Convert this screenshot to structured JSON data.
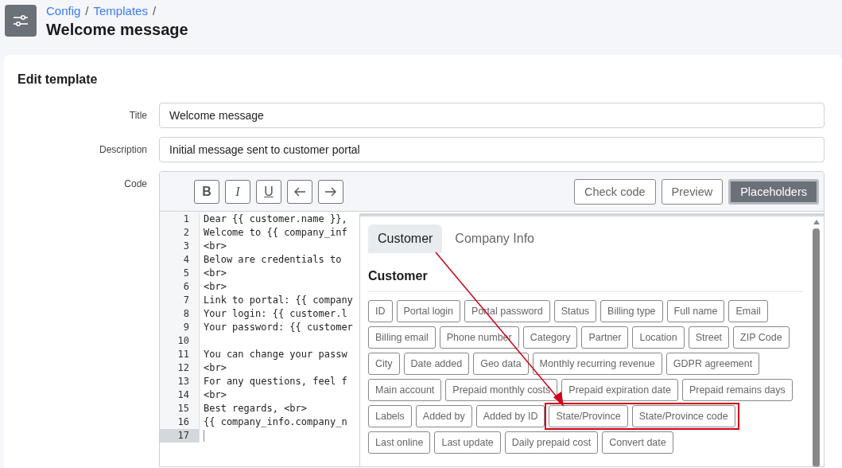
{
  "header": {
    "breadcrumb": [
      "Config",
      "Templates"
    ],
    "separator": "/",
    "title": "Welcome message"
  },
  "form": {
    "heading": "Edit template",
    "fields": [
      {
        "label": "Title",
        "value": "Welcome message"
      },
      {
        "label": "Description",
        "value": "Initial message sent to customer portal"
      }
    ],
    "code_label": "Code"
  },
  "toolbar": {
    "format_buttons": [
      {
        "kind": "bold",
        "label": "B"
      },
      {
        "kind": "italic",
        "label": "I"
      },
      {
        "kind": "underline",
        "label": "U"
      },
      {
        "kind": "undo"
      },
      {
        "kind": "redo"
      }
    ],
    "actions": [
      {
        "label": "Check code",
        "selected": false
      },
      {
        "label": "Preview",
        "selected": false
      },
      {
        "label": "Placeholders",
        "selected": true
      }
    ]
  },
  "code_lines": [
    {
      "number": "1",
      "text": "Dear {{ customer.name }},",
      "current": false
    },
    {
      "number": "2",
      "text": "Welcome to {{ company_inf",
      "current": false
    },
    {
      "number": "3",
      "text": "<br>",
      "current": false
    },
    {
      "number": "4",
      "text": "Below are credentials to",
      "current": false
    },
    {
      "number": "5",
      "text": "<br>",
      "current": false
    },
    {
      "number": "6",
      "text": "<br>",
      "current": false
    },
    {
      "number": "7",
      "text": "Link to portal: {{ company",
      "current": false
    },
    {
      "number": "8",
      "text": "Your login: {{ customer.l",
      "current": false
    },
    {
      "number": "9",
      "text": "Your password: {{ customer",
      "current": false
    },
    {
      "number": "10",
      "current": false
    },
    {
      "number": "11",
      "text": "You can change your passw",
      "current": false
    },
    {
      "number": "12",
      "text": "<br>",
      "current": false
    },
    {
      "number": "13",
      "text": "For any questions, feel f",
      "current": false
    },
    {
      "number": "14",
      "text": "<br>",
      "current": false
    },
    {
      "number": "15",
      "text": "Best regards, <br>",
      "current": false
    },
    {
      "number": "16",
      "text": "{{ company_info.company_n",
      "current": false
    },
    {
      "number": "17",
      "current": true
    }
  ],
  "placeholders": {
    "tabs": [
      {
        "label": "Customer",
        "selected": true
      },
      {
        "label": "Company Info",
        "selected": false
      }
    ],
    "section_title": "Customer",
    "chips": [
      {
        "label": "ID",
        "highlighted": false
      },
      {
        "label": "Portal login",
        "highlighted": false
      },
      {
        "label": "Portal password",
        "highlighted": false
      },
      {
        "label": "Status",
        "highlighted": false
      },
      {
        "label": "Billing type",
        "highlighted": false
      },
      {
        "label": "Full name",
        "highlighted": false
      },
      {
        "label": "Email",
        "highlighted": false
      },
      {
        "label": "Billing email",
        "highlighted": false
      },
      {
        "label": "Phone number",
        "highlighted": false
      },
      {
        "label": "Category",
        "highlighted": false
      },
      {
        "label": "Partner",
        "highlighted": false
      },
      {
        "label": "Location",
        "highlighted": false
      },
      {
        "label": "Street",
        "highlighted": false
      },
      {
        "label": "ZIP Code",
        "highlighted": false
      },
      {
        "label": "City",
        "highlighted": false
      },
      {
        "label": "Date added",
        "highlighted": false
      },
      {
        "label": "Geo data",
        "highlighted": false
      },
      {
        "label": "Monthly recurring revenue",
        "highlighted": false
      },
      {
        "label": "GDPR agreement",
        "highlighted": false
      },
      {
        "label": "Main account",
        "highlighted": false
      },
      {
        "label": "Prepaid monthly costs",
        "highlighted": false
      },
      {
        "label": "Prepaid expiration date",
        "highlighted": false
      },
      {
        "label": "Prepaid remains days",
        "highlighted": false
      },
      {
        "label": "Labels",
        "highlighted": false
      },
      {
        "label": "Added by",
        "highlighted": false
      },
      {
        "label": "Added by ID",
        "highlighted": false
      },
      {
        "label": "State/Province",
        "highlighted": true
      },
      {
        "label": "State/Province code",
        "highlighted": true
      },
      {
        "label": "Last online",
        "highlighted": false
      },
      {
        "label": "Last update",
        "highlighted": false
      },
      {
        "label": "Daily prepaid cost",
        "highlighted": false
      },
      {
        "label": "Convert date",
        "highlighted": false
      }
    ],
    "annotation_arrow": true
  }
}
